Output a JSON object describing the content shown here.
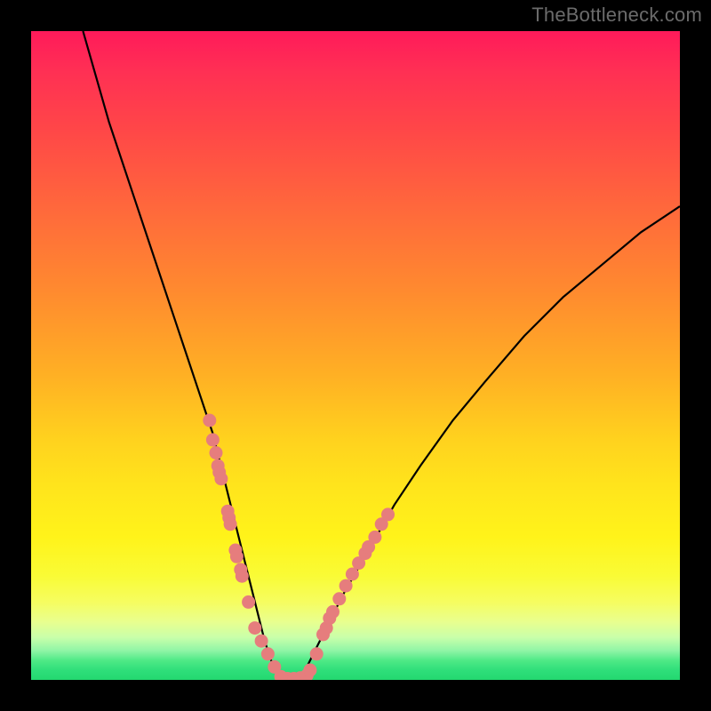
{
  "watermark": "TheBottleneck.com",
  "chart_data": {
    "type": "line",
    "title": "",
    "xlabel": "",
    "ylabel": "",
    "xlim": [
      0,
      100
    ],
    "ylim": [
      0,
      100
    ],
    "series": [
      {
        "name": "bottleneck-curve",
        "x": [
          8,
          10,
          12,
          14,
          16,
          18,
          20,
          22,
          24,
          26,
          28,
          29,
          30,
          31,
          32,
          33,
          34,
          35,
          36,
          37,
          38,
          39,
          40,
          41,
          42,
          43,
          45,
          48,
          52,
          56,
          60,
          65,
          70,
          76,
          82,
          88,
          94,
          100
        ],
        "y": [
          100,
          93,
          86,
          80,
          74,
          68,
          62,
          56,
          50,
          44,
          38,
          34,
          30,
          26,
          22,
          18,
          14,
          10,
          6,
          3,
          1,
          0,
          0,
          0,
          1,
          3,
          7,
          13,
          20,
          27,
          33,
          40,
          46,
          53,
          59,
          64,
          69,
          73
        ]
      }
    ],
    "scatter": [
      {
        "name": "dots-left",
        "x": [
          27.5,
          28.0,
          28.5,
          28.8,
          29.0,
          29.3,
          30.3,
          30.5,
          30.7,
          31.5,
          31.7,
          32.3,
          32.5,
          33.5,
          34.5,
          35.5,
          36.5,
          37.5
        ],
        "y": [
          40,
          37,
          35,
          33,
          32,
          31,
          26,
          25,
          24,
          20,
          19,
          17,
          16,
          12,
          8,
          6,
          4,
          2
        ]
      },
      {
        "name": "dots-bottom",
        "x": [
          38.5,
          39.5,
          40.5,
          41.5,
          42.5,
          43.0
        ],
        "y": [
          0.5,
          0.2,
          0.2,
          0.3,
          0.7,
          1.5
        ]
      },
      {
        "name": "dots-right",
        "x": [
          44.0,
          45.0,
          45.5,
          46.0,
          46.5,
          47.5,
          48.5,
          49.5,
          50.5,
          51.5,
          52.0,
          53.0,
          54.0,
          55.0
        ],
        "y": [
          4,
          7,
          8,
          9.5,
          10.5,
          12.5,
          14.5,
          16.3,
          18,
          19.5,
          20.5,
          22,
          24,
          25.5
        ]
      }
    ],
    "colors": {
      "curve": "#000000",
      "dots": "#e67d7d",
      "background_top": "#ff1a5a",
      "background_bottom": "#24d870"
    }
  }
}
